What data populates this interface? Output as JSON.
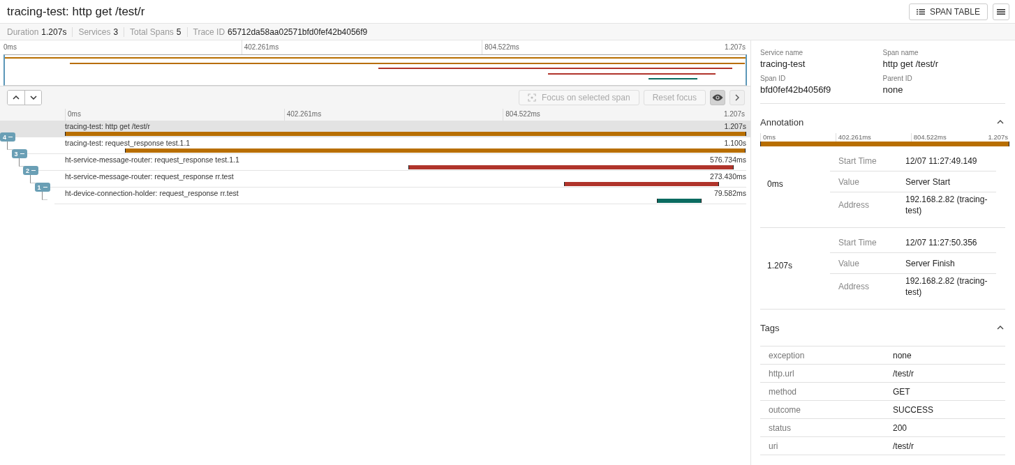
{
  "header": {
    "title": "tracing-test: http get /test/r",
    "span_table_button": "SPAN TABLE"
  },
  "summary": [
    {
      "label": "Duration",
      "value": "1.207s"
    },
    {
      "label": "Services",
      "value": "3"
    },
    {
      "label": "Total Spans",
      "value": "5"
    },
    {
      "label": "Trace ID",
      "value": "65712da58aa02571bfd0fef42b4056f9"
    }
  ],
  "minimap": {
    "ticks": [
      "0ms",
      "402.261ms",
      "804.522ms",
      "1.207s"
    ]
  },
  "toolbar": {
    "focus_button": {
      "label": "Focus on selected span",
      "disabled": true
    },
    "reset_button": {
      "label": "Reset focus",
      "disabled": true
    },
    "visibility_toggle": {
      "pressed": true
    }
  },
  "ruler": {
    "ticks": [
      "0ms",
      "402.261ms",
      "804.522ms",
      "1.207s"
    ]
  },
  "spans": [
    {
      "name": "tracing-test: http get /test/r",
      "duration": "1.207s",
      "color": "#b86e00",
      "selected": true,
      "badge": "4",
      "expanded": true,
      "children": [
        {
          "name": "tracing-test: request_response test.1.1",
          "duration": "1.100s",
          "color": "#b86e00",
          "selected": false,
          "badge": "3",
          "expanded": true,
          "children": [
            {
              "name": "ht-service-message-router: request_response test.1.1",
              "duration": "576.734ms",
              "color": "#b0342b",
              "selected": false,
              "badge": "2",
              "expanded": true,
              "children": [
                {
                  "name": "ht-service-message-router: request_response rr.test",
                  "duration": "273.430ms",
                  "color": "#b0342b",
                  "selected": false,
                  "badge": "1",
                  "expanded": true,
                  "children": [
                    {
                      "name": "ht-device-connection-holder: request_response rr.test",
                      "duration": "79.582ms",
                      "color": "#0b6b60",
                      "selected": false
                    }
                  ]
                }
              ]
            }
          ]
        }
      ]
    }
  ],
  "details": {
    "fields": [
      {
        "label": "Service name",
        "value": "tracing-test"
      },
      {
        "label": "Span name",
        "value": "http get /test/r"
      },
      {
        "label": "Span ID",
        "value": "bfd0fef42b4056f9"
      },
      {
        "label": "Parent ID",
        "value": "none"
      }
    ],
    "annotation": {
      "title": "Annotation",
      "expanded": true,
      "ticks": [
        "0ms",
        "402.261ms",
        "804.522ms",
        "1.207s"
      ],
      "entries": [
        {
          "time": "0ms",
          "rows": [
            {
              "key": "Start Time",
              "value": "12/07 11:27:49.149"
            },
            {
              "key": "Value",
              "value": "Server Start"
            },
            {
              "key": "Address",
              "value": "192.168.2.82 (tracing-test)"
            }
          ]
        },
        {
          "time": "1.207s",
          "rows": [
            {
              "key": "Start Time",
              "value": "12/07 11:27:50.356"
            },
            {
              "key": "Value",
              "value": "Server Finish"
            },
            {
              "key": "Address",
              "value": "192.168.2.82 (tracing-test)"
            }
          ]
        }
      ]
    },
    "tags": {
      "title": "Tags",
      "expanded": true,
      "rows": [
        {
          "key": "exception",
          "value": "none"
        },
        {
          "key": "http.url",
          "value": "/test/r"
        },
        {
          "key": "method",
          "value": "GET"
        },
        {
          "key": "outcome",
          "value": "SUCCESS"
        },
        {
          "key": "status",
          "value": "200"
        },
        {
          "key": "uri",
          "value": "/test/r"
        }
      ]
    }
  }
}
